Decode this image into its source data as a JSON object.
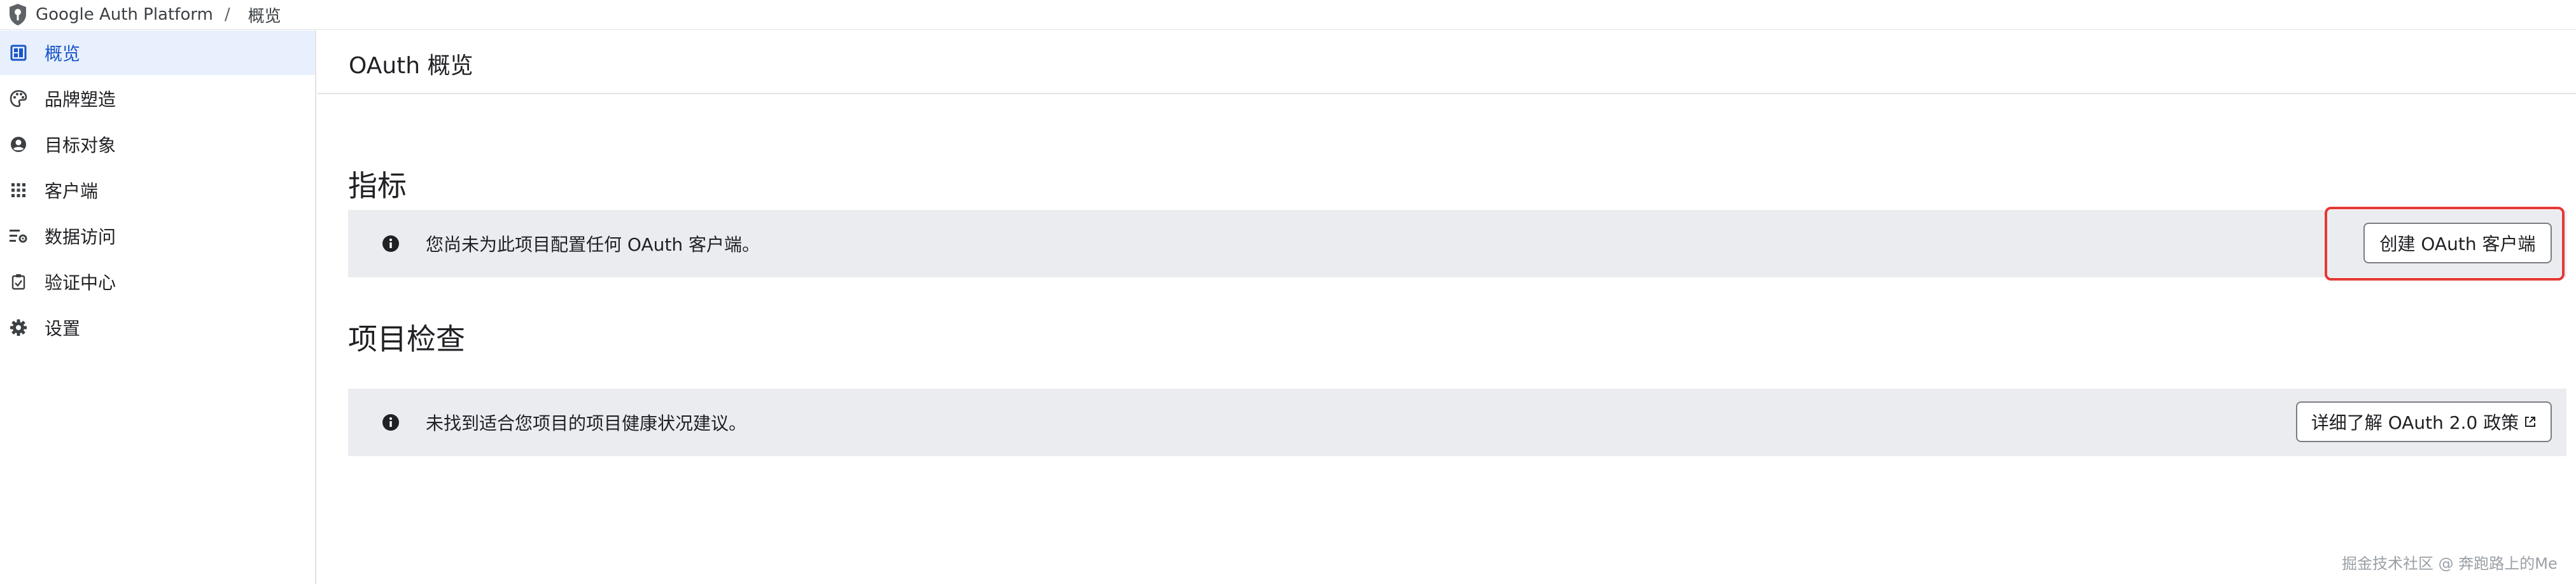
{
  "header": {
    "app_name": "Google Auth Platform",
    "separator": "/",
    "current_page": "概览"
  },
  "sidebar": {
    "items": [
      {
        "label": "概览",
        "icon": "dashboard-icon",
        "active": true
      },
      {
        "label": "品牌塑造",
        "icon": "palette-icon",
        "active": false
      },
      {
        "label": "目标对象",
        "icon": "account-circle-icon",
        "active": false
      },
      {
        "label": "客户端",
        "icon": "apps-grid-icon",
        "active": false
      },
      {
        "label": "数据访问",
        "icon": "data-settings-icon",
        "active": false
      },
      {
        "label": "验证中心",
        "icon": "verified-check-icon",
        "active": false
      },
      {
        "label": "设置",
        "icon": "gear-icon",
        "active": false
      }
    ]
  },
  "main": {
    "title": "OAuth 概览",
    "metrics": {
      "title": "指标",
      "message": "您尚未为此项目配置任何 OAuth 客户端。",
      "button_label": "创建 OAuth 客户端"
    },
    "project_check": {
      "title": "项目检查",
      "message": "未找到适合您项目的项目健康状况建议。",
      "button_label": "详细了解 OAuth 2.0 政策"
    }
  },
  "watermark": "掘金技术社区 @ 奔跑路上的Me",
  "colors": {
    "accent": "#1a56c8",
    "active_bg": "#e8f0fe",
    "banner_bg": "#ebecf0",
    "highlight": "#e53935"
  }
}
